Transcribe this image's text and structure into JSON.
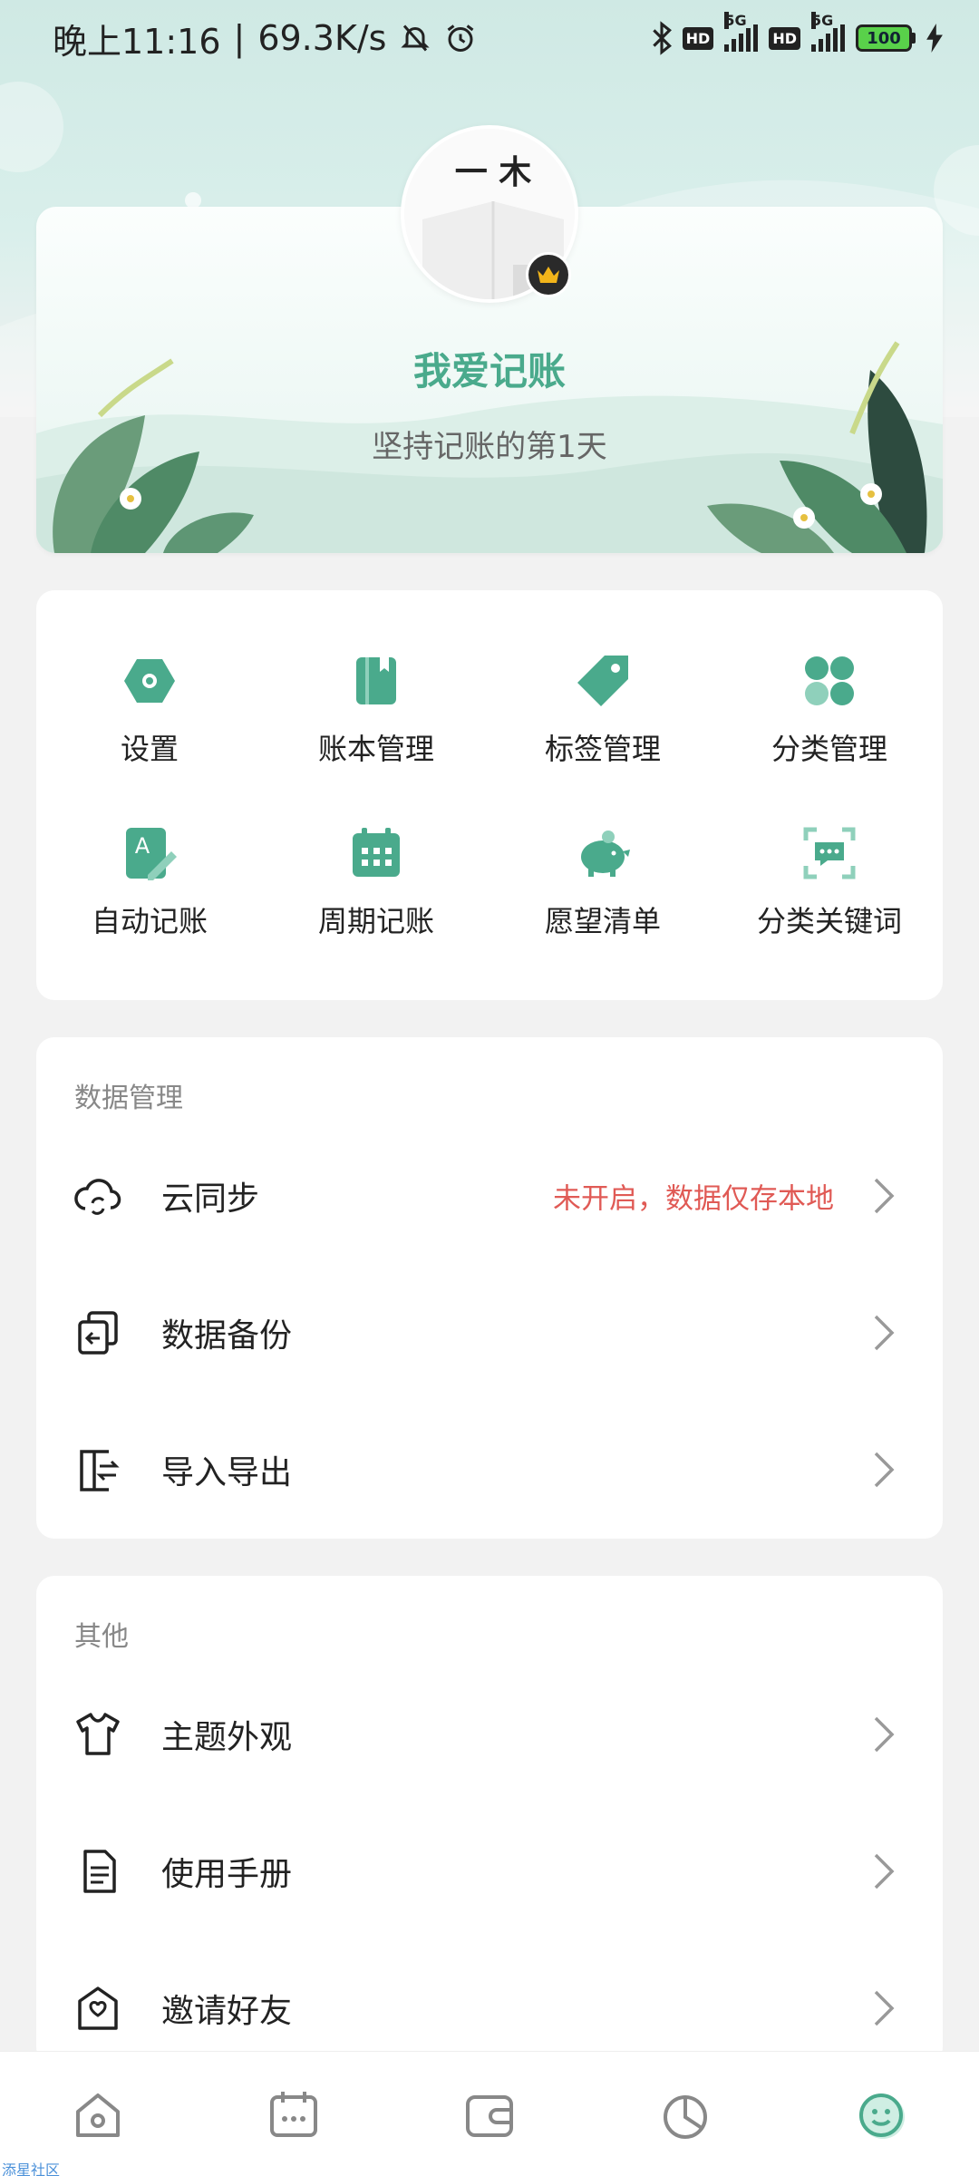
{
  "status_bar": {
    "time": "晚上11:16",
    "speed": "69.3K/s",
    "network1": "5G",
    "network2": "5G",
    "hd": "HD",
    "battery": "100"
  },
  "profile": {
    "avatar_text": "一 木",
    "name": "我爱记账",
    "subtitle": "坚持记账的第1天"
  },
  "grid": [
    {
      "label": "设置",
      "icon": "settings-hex-icon"
    },
    {
      "label": "账本管理",
      "icon": "book-icon"
    },
    {
      "label": "标签管理",
      "icon": "tag-icon"
    },
    {
      "label": "分类管理",
      "icon": "category-icon"
    },
    {
      "label": "自动记账",
      "icon": "auto-write-icon"
    },
    {
      "label": "周期记账",
      "icon": "calendar-icon"
    },
    {
      "label": "愿望清单",
      "icon": "piggy-bank-icon"
    },
    {
      "label": "分类关键词",
      "icon": "keyword-scan-icon"
    }
  ],
  "data_section": {
    "title": "数据管理",
    "items": [
      {
        "label": "云同步",
        "status": "未开启，数据仅存本地",
        "icon": "cloud-sync-icon"
      },
      {
        "label": "数据备份",
        "icon": "backup-icon"
      },
      {
        "label": "导入导出",
        "icon": "import-export-icon"
      }
    ]
  },
  "other_section": {
    "title": "其他",
    "items": [
      {
        "label": "主题外观",
        "icon": "shirt-icon"
      },
      {
        "label": "使用手册",
        "icon": "manual-icon"
      },
      {
        "label": "邀请好友",
        "icon": "invite-icon"
      }
    ]
  },
  "bottom_nav": [
    "home-icon",
    "calendar-icon",
    "wallet-icon",
    "pie-chart-icon",
    "profile-face-icon"
  ],
  "watermark": "添星社区",
  "colors": {
    "accent": "#4aaa8c",
    "warning": "#e05a55"
  }
}
